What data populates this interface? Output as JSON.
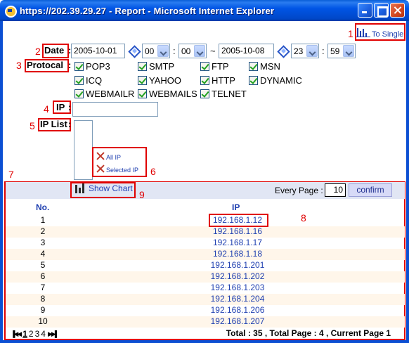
{
  "window": {
    "title": "https://202.39.29.27 - Report - Microsoft Internet Explorer"
  },
  "to_single": {
    "label": "To Single"
  },
  "form": {
    "date_label": "Date",
    "date_from": "2005-10-01",
    "hour_from": "00",
    "min_from": "00",
    "range_sep": "~",
    "time_sep": ":",
    "date_to": "2005-10-08",
    "hour_to": "23",
    "min_to": "59",
    "protocol_label": "Protocal",
    "protocols": [
      "POP3",
      "SMTP",
      "FTP",
      "MSN",
      "ICQ",
      "YAHOO",
      "HTTP",
      "DYNAMIC",
      "WEBMAILR",
      "WEBMAILS",
      "TELNET"
    ],
    "ip_label": "IP",
    "ip_list_label": "IP List",
    "all_ip": "All IP",
    "selected_ip": "Selected IP"
  },
  "callouts": [
    "1",
    "2",
    "3",
    "4",
    "5",
    "6",
    "7",
    "8",
    "9"
  ],
  "results": {
    "show_chart": "Show Chart",
    "every_page_label": "Every Page :",
    "every_page_value": "10",
    "confirm": "confirm",
    "col_no": "No.",
    "col_ip": "IP",
    "rows": [
      {
        "no": "1",
        "ip": "192.168.1.12"
      },
      {
        "no": "2",
        "ip": "192.168.1.16"
      },
      {
        "no": "3",
        "ip": "192.168.1.17"
      },
      {
        "no": "4",
        "ip": "192.168.1.18"
      },
      {
        "no": "5",
        "ip": "192.168.1.201"
      },
      {
        "no": "6",
        "ip": "192.168.1.202"
      },
      {
        "no": "7",
        "ip": "192.168.1.203"
      },
      {
        "no": "8",
        "ip": "192.168.1.204"
      },
      {
        "no": "9",
        "ip": "192.168.1.206"
      },
      {
        "no": "10",
        "ip": "192.168.1.207"
      }
    ],
    "pages": [
      "1",
      "2",
      "3",
      "4"
    ],
    "total": "Total : 35 , Total Page : 4 , Current Page 1"
  },
  "colors": {
    "titlebar": "#0055e5",
    "callout": "#e00000",
    "link": "#1f3fb0",
    "header_bg": "#e1e6f4",
    "alt_row": "#fff6ea"
  }
}
